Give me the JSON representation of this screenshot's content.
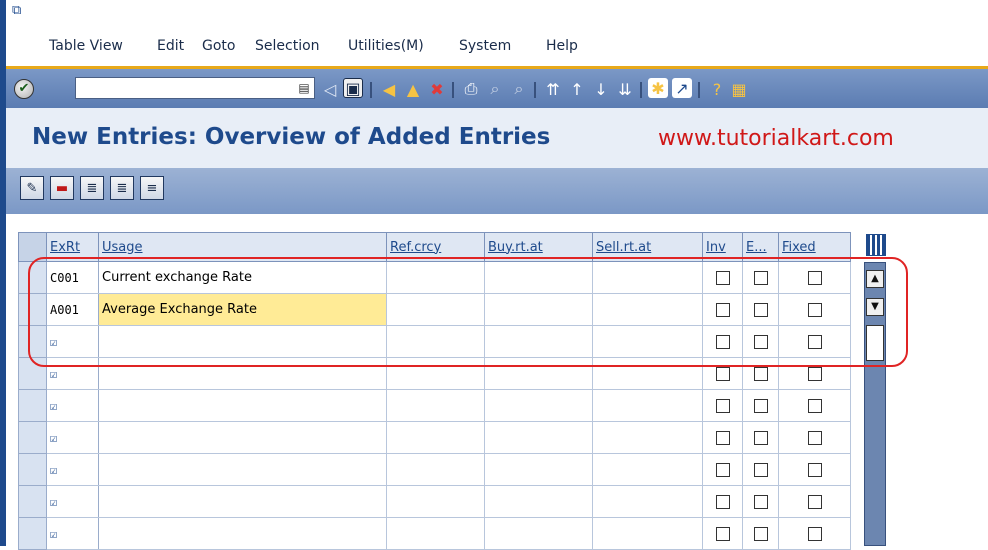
{
  "menu": {
    "items": [
      {
        "label": "Table View"
      },
      {
        "label": "Edit"
      },
      {
        "label": "Goto"
      },
      {
        "label": "Selection"
      },
      {
        "label": "Utilities(M)"
      },
      {
        "label": "System"
      },
      {
        "label": "Help"
      }
    ]
  },
  "toolbar": {
    "command_value": "",
    "icons": [
      "enter-icon",
      "back-icon",
      "save-icon",
      "back-nav-icon",
      "exit-icon",
      "cancel-icon",
      "print-icon",
      "find-icon",
      "find-next-icon",
      "first-page-icon",
      "previous-page-icon",
      "next-page-icon",
      "last-page-icon",
      "create-session-icon",
      "shortcut-icon",
      "help-icon",
      "layout-icon"
    ]
  },
  "title": {
    "text": "New Entries: Overview of Added Entries",
    "watermark": "www.tutorialkart.com"
  },
  "app_toolbar": {
    "icons": [
      "change-display-icon",
      "delete-icon",
      "select-all-icon",
      "select-block-icon",
      "deselect-all-icon"
    ]
  },
  "table": {
    "columns": [
      "ExRt",
      "Usage",
      "Ref.crcy",
      "Buy.rt.at",
      "Sell.rt.at",
      "Inv",
      "E...",
      "Fixed"
    ],
    "rows": [
      {
        "exrt": "C001",
        "usage": "Current exchange Rate"
      },
      {
        "exrt": "A001",
        "usage": "Average Exchange Rate"
      },
      {
        "exrt": "",
        "usage": ""
      },
      {
        "exrt": "",
        "usage": ""
      },
      {
        "exrt": "",
        "usage": ""
      },
      {
        "exrt": "",
        "usage": ""
      },
      {
        "exrt": "",
        "usage": ""
      },
      {
        "exrt": "",
        "usage": ""
      },
      {
        "exrt": "",
        "usage": ""
      }
    ],
    "new_row_marker": "☑"
  },
  "colors": {
    "title_blue": "#1e4a8c",
    "watermark_red": "#d01818",
    "highlight_yellow": "#ffeb96",
    "outline_red": "#e02424"
  }
}
